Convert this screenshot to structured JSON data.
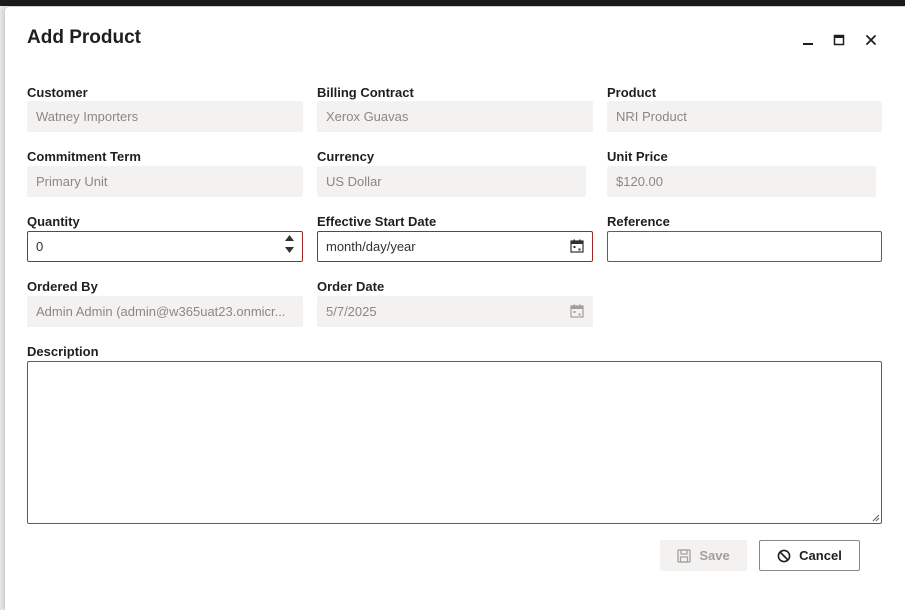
{
  "dialog": {
    "title": "Add Product",
    "controls": {
      "minimize": "minimize-icon",
      "maximize": "maximize-icon",
      "close": "close-icon"
    }
  },
  "fields": {
    "customer": {
      "label": "Customer",
      "value": "Watney Importers"
    },
    "billing_contract": {
      "label": "Billing Contract",
      "value": "Xerox Guavas"
    },
    "product": {
      "label": "Product",
      "value": "NRI Product"
    },
    "commitment_term": {
      "label": "Commitment Term",
      "value": "Primary Unit"
    },
    "currency": {
      "label": "Currency",
      "value": "US Dollar"
    },
    "unit_price": {
      "label": "Unit Price",
      "value": "$120.00"
    },
    "quantity": {
      "label": "Quantity",
      "value": "0"
    },
    "effective_start_date": {
      "label": "Effective Start Date",
      "placeholder": "month/day/year"
    },
    "reference": {
      "label": "Reference",
      "value": ""
    },
    "ordered_by": {
      "label": "Ordered By",
      "value": "Admin Admin (admin@w365uat23.onmicr..."
    },
    "order_date": {
      "label": "Order Date",
      "value": "5/7/2025"
    },
    "description": {
      "label": "Description",
      "value": ""
    }
  },
  "buttons": {
    "save": "Save",
    "cancel": "Cancel"
  },
  "colors": {
    "invalid_border": "#a4262c",
    "disabled_bg": "#f3f2f1",
    "disabled_text": "#8a8886"
  }
}
